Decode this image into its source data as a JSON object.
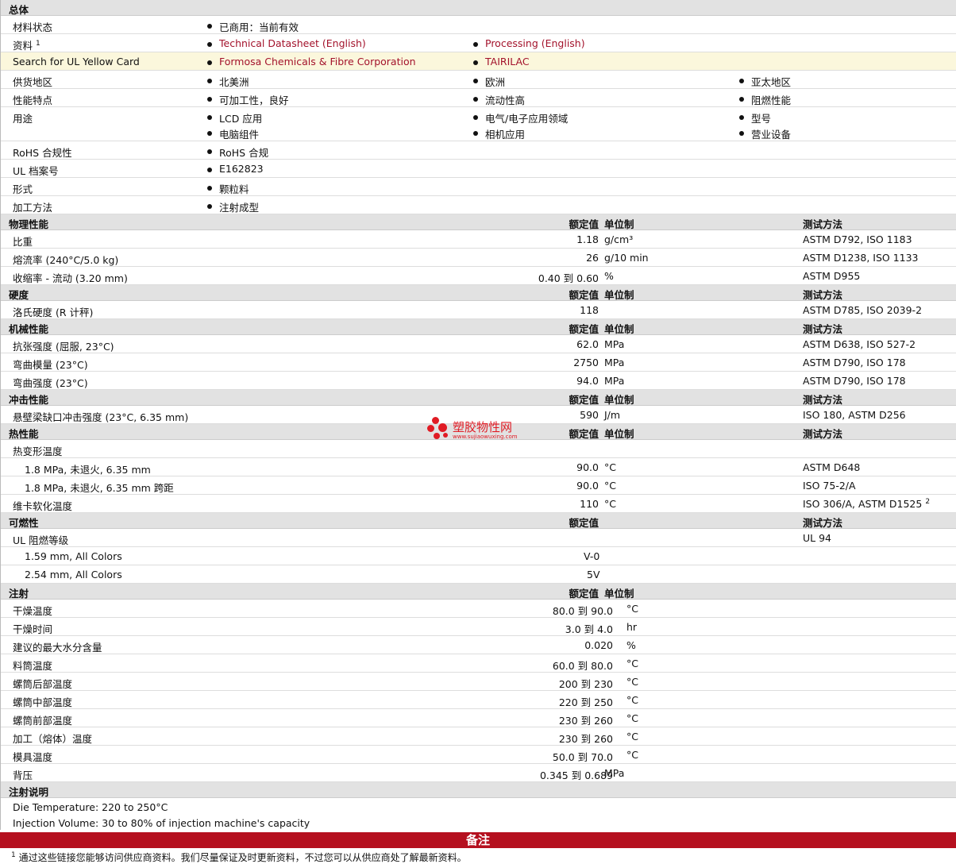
{
  "general": {
    "title": "总体",
    "material_status_label": "材料状态",
    "material_status_value": "已商用：当前有效",
    "docs_label": "资料",
    "docs_sup": "1",
    "doc1": "Technical Datasheet (English)",
    "doc2": "Processing (English)",
    "ul_label": "Search for UL Yellow Card",
    "ul_company": "Formosa Chemicals & Fibre Corporation",
    "ul_brand": "TAIRILAC",
    "supply_label": "供货地区",
    "supply": [
      "北美洲",
      "欧洲",
      "亚太地区"
    ],
    "features_label": "性能特点",
    "features": [
      "可加工性，良好",
      "流动性高",
      "阻燃性能"
    ],
    "uses_label": "用途",
    "uses": [
      "LCD 应用",
      "电气/电子应用领域",
      "型号",
      "电脑组件",
      "相机应用",
      "营业设备"
    ],
    "rohs_label": "RoHS 合规性",
    "rohs_value": "RoHS 合规",
    "ulfile_label": "UL 档案号",
    "ulfile_value": "E162823",
    "form_label": "形式",
    "form_value": "颗粒料",
    "process_label": "加工方法",
    "process_value": "注射成型"
  },
  "headers": {
    "nominal": "额定值",
    "unit": "单位制",
    "method": "测试方法"
  },
  "physical": {
    "title": "物理性能",
    "rows": [
      {
        "label": "比重",
        "value": "1.18",
        "unit": "g/cm³",
        "method": "ASTM D792, ISO 1183"
      },
      {
        "label": "熔流率  (240°C/5.0 kg)",
        "value": "26",
        "unit": "g/10 min",
        "method": "ASTM D1238, ISO 1133"
      },
      {
        "label": "收缩率  - 流动  (3.20 mm)",
        "value": "0.40 到  0.60",
        "unit": "%",
        "method": "ASTM D955"
      }
    ]
  },
  "hardness": {
    "title": "硬度",
    "rows": [
      {
        "label": "洛氏硬度  (R 计秤)",
        "value": "118",
        "unit": "",
        "method": "ASTM D785, ISO 2039-2"
      }
    ]
  },
  "mechanical": {
    "title": "机械性能",
    "rows": [
      {
        "label": "抗张强度  (屈服, 23°C)",
        "value": "62.0",
        "unit": "MPa",
        "method": "ASTM D638, ISO 527-2"
      },
      {
        "label": "弯曲模量  (23°C)",
        "value": "2750",
        "unit": "MPa",
        "method": "ASTM D790, ISO 178"
      },
      {
        "label": "弯曲强度  (23°C)",
        "value": "94.0",
        "unit": "MPa",
        "method": "ASTM D790, ISO 178"
      }
    ]
  },
  "impact": {
    "title": "冲击性能",
    "rows": [
      {
        "label": "悬壁梁缺口冲击强度  (23°C, 6.35 mm)",
        "value": "590",
        "unit": "J/m",
        "method": "ISO 180, ASTM D256"
      }
    ]
  },
  "thermal": {
    "title": "热性能",
    "hdt_label": "热变形温度",
    "rows": [
      {
        "label": "1.8 MPa, 未退火, 6.35 mm",
        "value": "90.0",
        "unit": "°C",
        "method": "ASTM D648"
      },
      {
        "label": "1.8 MPa, 未退火, 6.35 mm 跨距",
        "value": "90.0",
        "unit": "°C",
        "method": "ISO 75-2/A"
      }
    ],
    "vicat_label": "维卡软化温度",
    "vicat_value": "110",
    "vicat_unit": "°C",
    "vicat_method": "ISO 306/A, ASTM D1525",
    "vicat_sup": "2"
  },
  "flammability": {
    "title": "可燃性",
    "ul94_label": "UL 阻燃等级",
    "ul94_method": "UL 94",
    "rows": [
      {
        "label": "1.59 mm, All Colors",
        "value": "V-0"
      },
      {
        "label": "2.54 mm, All Colors",
        "value": "5V"
      }
    ]
  },
  "injection": {
    "title": "注射",
    "rows": [
      {
        "label": "干燥温度",
        "value": "80.0 到  90.0",
        "unit": "°C"
      },
      {
        "label": "干燥时间",
        "value": "3.0 到  4.0",
        "unit": "hr"
      },
      {
        "label": "建议的最大水分含量",
        "value": "0.020",
        "unit": "%"
      },
      {
        "label": "料筒温度",
        "value": "60.0 到  80.0",
        "unit": "°C"
      },
      {
        "label": "螺筒后部温度",
        "value": "200 到  230",
        "unit": "°C"
      },
      {
        "label": "螺筒中部温度",
        "value": "220 到  250",
        "unit": "°C"
      },
      {
        "label": "螺筒前部温度",
        "value": "230 到  260",
        "unit": "°C"
      },
      {
        "label": "加工（熔体）温度",
        "value": "230 到  260",
        "unit": "°C"
      },
      {
        "label": "模具温度",
        "value": "50.0 到  70.0",
        "unit": "°C"
      },
      {
        "label": "背压",
        "value": "0.345 到  0.689",
        "unit": "MPa"
      }
    ]
  },
  "injection_notes": {
    "title": "注射说明",
    "lines": [
      "Die Temperature: 220 to 250°C",
      "Injection Volume: 30 to 80% of injection machine's capacity"
    ]
  },
  "notes": {
    "title": "备注",
    "sup": "1",
    "line1": "通过这些链接您能够访问供应商资料。我们尽量保证及时更新资料，不过您可以从供应商处了解最新资料。"
  },
  "watermark": {
    "text": "塑胶物性网",
    "url": "www.sujiaowuxing.com"
  }
}
